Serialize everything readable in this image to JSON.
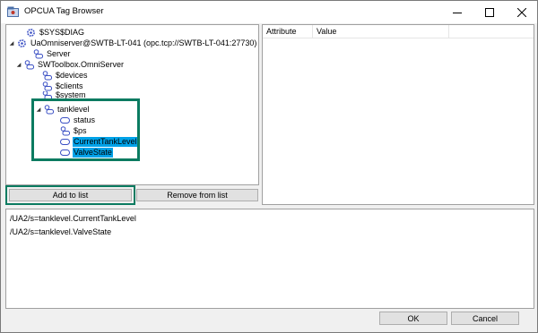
{
  "window": {
    "title": "OPCUA Tag Browser"
  },
  "tree": {
    "items": [
      {
        "label": "$SYS$DIAG",
        "icon": "gear-icon"
      },
      {
        "label": "UaOmniserver@SWTB-LT-041 (opc.tcp://SWTB-LT-041:27730)",
        "icon": "gear-icon",
        "expanded": true
      },
      {
        "label": "Server",
        "icon": "folder-tag-icon"
      },
      {
        "label": "SWToolbox.OmniServer",
        "icon": "folder-tag-icon",
        "expanded": true
      },
      {
        "label": "$devices",
        "icon": "folder-tag-icon"
      },
      {
        "label": "$clients",
        "icon": "folder-tag-icon"
      },
      {
        "label": "$system",
        "icon": "folder-tag-icon"
      },
      {
        "label": "tanklevel",
        "icon": "folder-tag-icon",
        "expanded": true
      },
      {
        "label": "status",
        "icon": "tag-icon"
      },
      {
        "label": "$ps",
        "icon": "folder-tag-icon"
      },
      {
        "label": "CurrentTankLevel",
        "icon": "tag-icon",
        "selected": true
      },
      {
        "label": "ValveState",
        "icon": "tag-icon",
        "selected": true
      }
    ]
  },
  "attributes": {
    "columns": [
      "Attribute",
      "Value"
    ]
  },
  "buttons": {
    "add": "Add to list",
    "remove": "Remove from list",
    "ok": "OK",
    "cancel": "Cancel"
  },
  "paths": [
    "/UA2/s=tanklevel.CurrentTankLevel",
    "/UA2/s=tanklevel.ValveState"
  ],
  "colors": {
    "selection": "#00a2e8",
    "highlight_frame": "#0b7b61"
  }
}
